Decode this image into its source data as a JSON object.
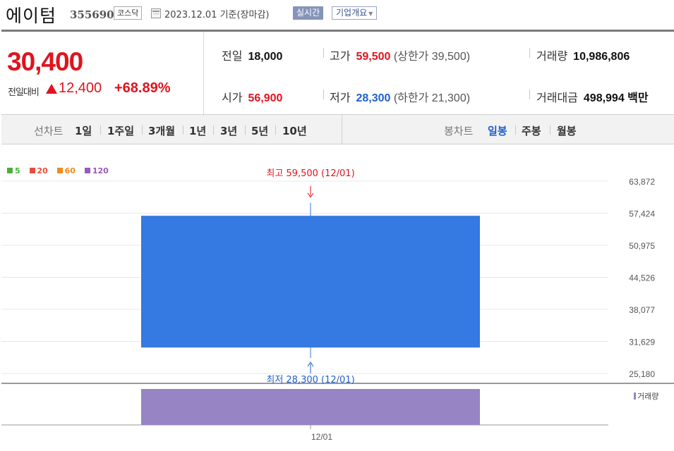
{
  "header": {
    "stock_name": "에이텀",
    "stock_code": "355690",
    "market": "코스닥",
    "date": "2023.12.01 기준(장마감)",
    "realtime_label": "실시간",
    "company_label": "기업개요"
  },
  "quote": {
    "price": "30,400",
    "change_label": "전일대비",
    "change_value": "12,400",
    "change_rate": "+68.89%",
    "prev_close_label": "전일",
    "prev_close": "18,000",
    "high_label": "고가",
    "high": "59,500",
    "upper_limit_label": "(상한가 39,500)",
    "volume_label": "거래량",
    "volume": "10,986,806",
    "open_label": "시가",
    "open": "56,900",
    "low_label": "저가",
    "low": "28,300",
    "lower_limit_label": "(하한가 21,300)",
    "amount_label": "거래대금",
    "amount": "498,994 백만"
  },
  "toolbar": {
    "line_chart_label": "선차트",
    "line_periods": [
      "1일",
      "1주일",
      "3개월",
      "1년",
      "3년",
      "5년",
      "10년"
    ],
    "candle_chart_label": "봉차트",
    "candle_periods": [
      "일봉",
      "주봉",
      "월봉"
    ],
    "active_candle": "일봉"
  },
  "legend": [
    {
      "label": "5",
      "color": "#4caf3a"
    },
    {
      "label": "20",
      "color": "#e84c3d"
    },
    {
      "label": "60",
      "color": "#f08a24"
    },
    {
      "label": "120",
      "color": "#9b59b6"
    }
  ],
  "colors": {
    "up": "#e0141e",
    "down": "#1f5fc9",
    "candle": "#3579e2",
    "volume": "#9684c4"
  },
  "chart_data": {
    "type": "candlestick",
    "x": [
      "12/01"
    ],
    "open": [
      56900
    ],
    "high": [
      59500
    ],
    "low": [
      28300
    ],
    "close": [
      30400
    ],
    "volume": [
      10986806
    ],
    "y_ticks": [
      "63,872",
      "57,424",
      "50,975",
      "44,526",
      "38,077",
      "31,629",
      "25,180"
    ],
    "ylim": [
      25180,
      63872
    ],
    "high_annotation": "최고 59,500 (12/01)",
    "low_annotation": "최저 28,300 (12/01)",
    "volume_label": "거래량",
    "grid": true
  }
}
